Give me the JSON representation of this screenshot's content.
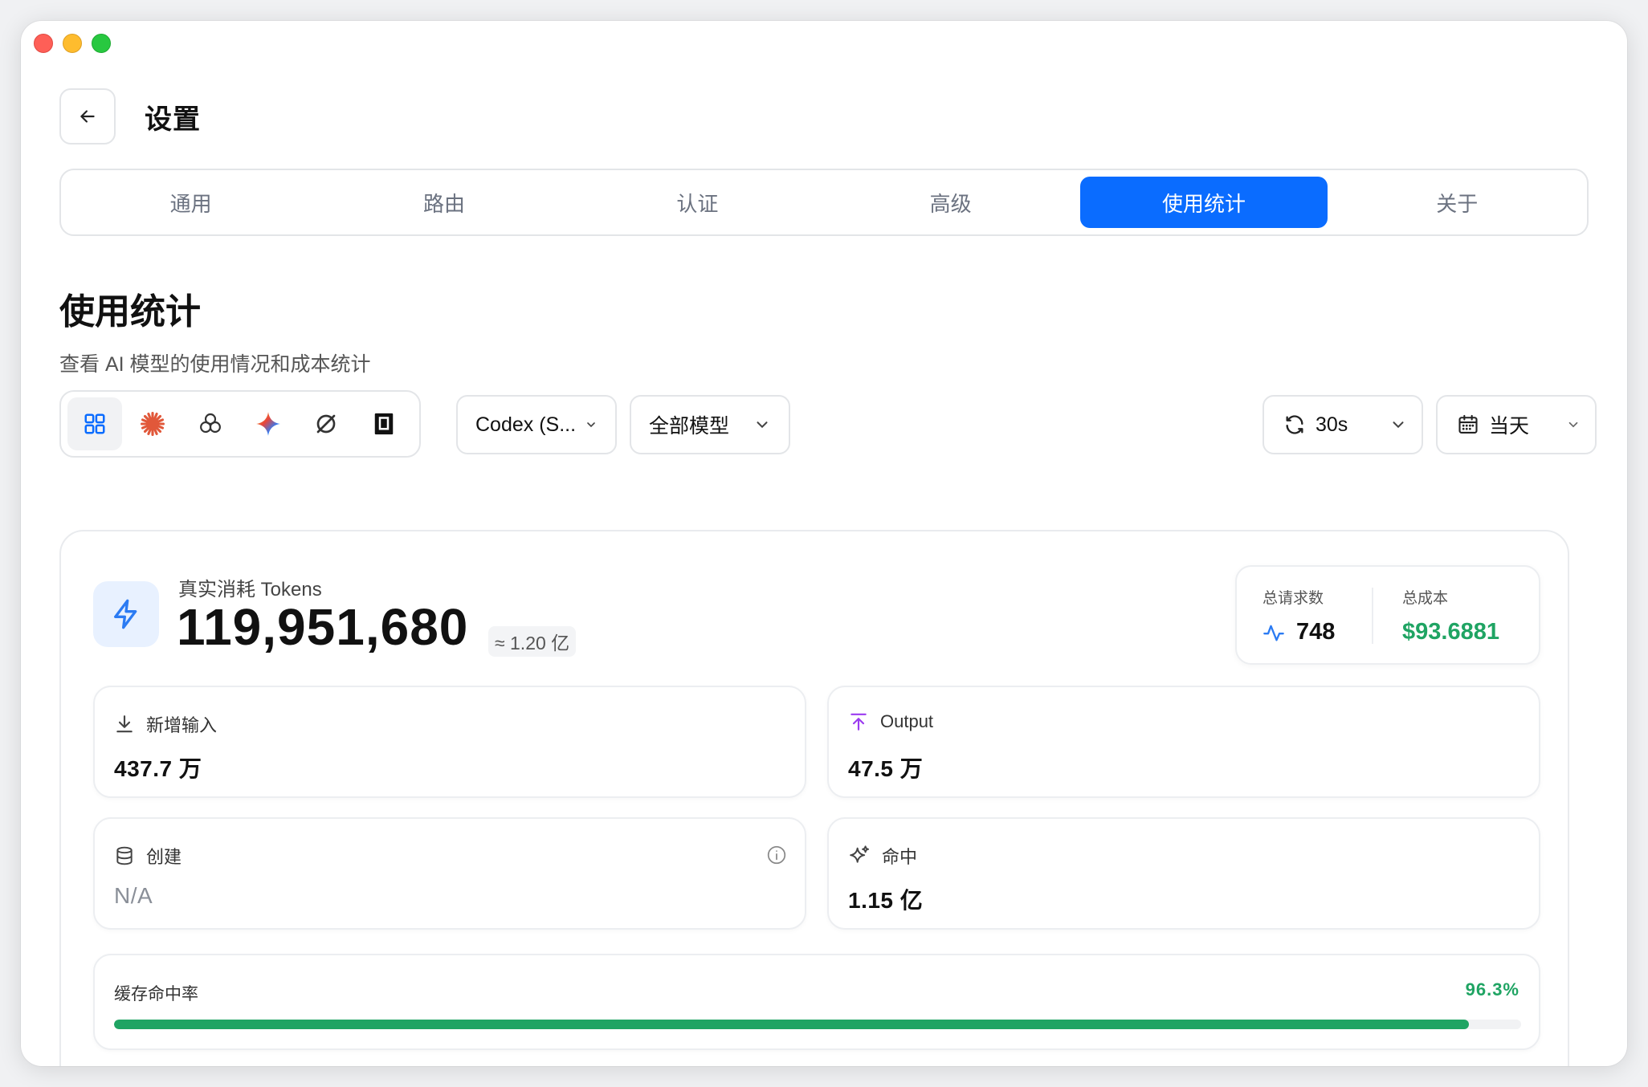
{
  "header": {
    "title": "设置"
  },
  "tabs": [
    {
      "label": "通用",
      "active": false
    },
    {
      "label": "路由",
      "active": false
    },
    {
      "label": "认证",
      "active": false
    },
    {
      "label": "高级",
      "active": false
    },
    {
      "label": "使用统计",
      "active": true
    },
    {
      "label": "关于",
      "active": false
    }
  ],
  "section": {
    "title": "使用统计",
    "description": "查看 AI 模型的使用情况和成本统计"
  },
  "toolbar": {
    "providers": [
      "all-grid-icon",
      "claude-icon",
      "openai-icon",
      "gemini-icon",
      "sync-provider-icon",
      "terminal-provider-icon"
    ],
    "source_select": "Codex (S...",
    "model_select": "全部模型",
    "refresh_select": "30s",
    "date_select": "当天"
  },
  "tokens": {
    "label": "真实消耗 Tokens",
    "value": "119,951,680",
    "approx": "≈ 1.20 亿"
  },
  "summary": {
    "requests_label": "总请求数",
    "requests_value": "748",
    "cost_label": "总成本",
    "cost_value": "$93.6881"
  },
  "stats": {
    "input": {
      "label": "新增输入",
      "value": "437.7 万"
    },
    "output": {
      "label": "Output",
      "value": "47.5 万"
    },
    "create": {
      "label": "创建",
      "value": "N/A"
    },
    "hit": {
      "label": "命中",
      "value": "1.15 亿"
    }
  },
  "cache_rate": {
    "label": "缓存命中率",
    "value": "96.3%",
    "fraction": 0.963
  },
  "colors": {
    "accent": "#0a6cff",
    "success": "#1fa463",
    "output_accent": "#9b3bf0"
  }
}
